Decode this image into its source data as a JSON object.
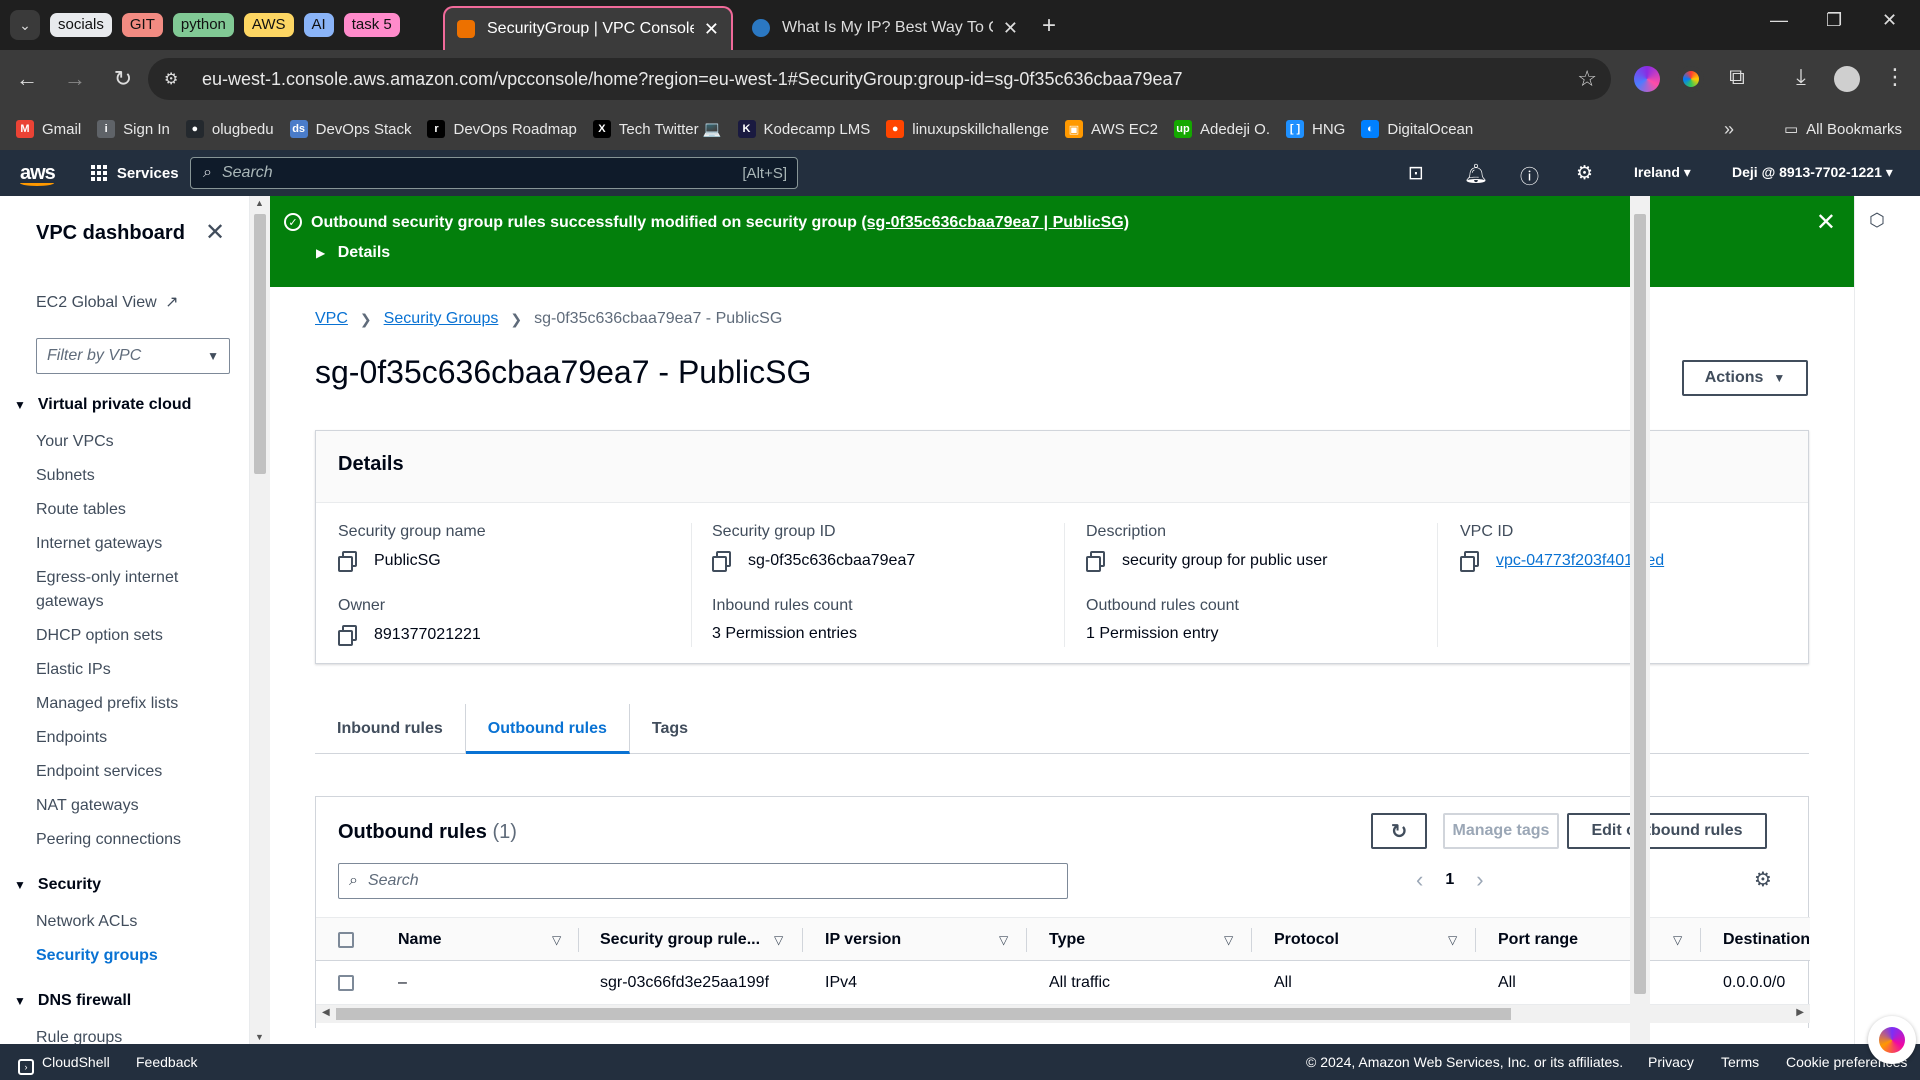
{
  "browser": {
    "tab_groups": [
      {
        "label": "socials",
        "color": "#e8eaed"
      },
      {
        "label": "GIT",
        "color": "#f28b82"
      },
      {
        "label": "python",
        "color": "#81c995"
      },
      {
        "label": "AWS",
        "color": "#fdd663"
      },
      {
        "label": "AI",
        "color": "#8ab4f8"
      },
      {
        "label": "task 5",
        "color": "#ff8bcb"
      }
    ],
    "active_tab": {
      "title": "SecurityGroup | VPC Console",
      "close": "✕"
    },
    "inactive_tab": {
      "title": "What Is My IP? Best Way To Check",
      "close": "✕"
    },
    "new_tab": "+",
    "url": "eu-west-1.console.aws.amazon.com/vpcconsole/home?region=eu-west-1#SecurityGroup:group-id=sg-0f35c636cbaa79ea7",
    "bookmarks": [
      {
        "label": "Gmail",
        "icon": "gmail-icon",
        "color": "#ea4335",
        "glyph": "M"
      },
      {
        "label": "Sign In",
        "icon": "signin-icon",
        "color": "#5f6368",
        "glyph": "i"
      },
      {
        "label": "olugbedu",
        "icon": "github-icon",
        "color": "#24292e",
        "glyph": "●"
      },
      {
        "label": "DevOps Stack",
        "icon": "devops-stack-icon",
        "color": "#4a7cc9",
        "glyph": "ds"
      },
      {
        "label": "DevOps Roadmap",
        "icon": "roadmap-icon",
        "color": "#000000",
        "glyph": "r"
      },
      {
        "label": "Tech Twitter 💻",
        "icon": "x-icon",
        "color": "#000000",
        "glyph": "X"
      },
      {
        "label": "Kodecamp LMS",
        "icon": "kodecamp-icon",
        "color": "#1a1a40",
        "glyph": "K"
      },
      {
        "label": "linuxupskillchallenge",
        "icon": "reddit-icon",
        "color": "#ff4500",
        "glyph": "●"
      },
      {
        "label": "AWS EC2",
        "icon": "aws-ec2-icon",
        "color": "#ff9900",
        "glyph": "▣"
      },
      {
        "label": "Adedeji O.",
        "icon": "upwork-icon",
        "color": "#14a800",
        "glyph": "up"
      },
      {
        "label": "HNG",
        "icon": "hng-icon",
        "color": "#1e90ff",
        "glyph": "[ ]"
      },
      {
        "label": "DigitalOcean",
        "icon": "digitalocean-icon",
        "color": "#0080ff",
        "glyph": "◐"
      }
    ],
    "bookmarks_more": "»",
    "all_bookmarks": "All Bookmarks"
  },
  "aws_nav": {
    "logo": "aws",
    "services": "Services",
    "search_placeholder": "Search",
    "search_shortcut": "[Alt+S]",
    "region": "Ireland ▾",
    "account": "Deji @ 8913-7702-1221 ▾"
  },
  "sidebar": {
    "title": "VPC dashboard",
    "ec2_global": "EC2 Global View",
    "filter_placeholder": "Filter by VPC",
    "sections": [
      {
        "label": "Virtual private cloud"
      },
      {
        "label": "Security"
      },
      {
        "label": "DNS firewall"
      }
    ],
    "vpc_items": [
      "Your VPCs",
      "Subnets",
      "Route tables",
      "Internet gateways",
      "Egress-only internet gateways",
      "DHCP option sets",
      "Elastic IPs",
      "Managed prefix lists",
      "Endpoints",
      "Endpoint services",
      "NAT gateways",
      "Peering connections"
    ],
    "security_items": [
      "Network ACLs",
      "Security groups"
    ],
    "dns_items": [
      "Rule groups"
    ]
  },
  "flash": {
    "message": "Outbound security group rules successfully modified on security group",
    "link": "(sg-0f35c636cbaa79ea7 | PublicSG)",
    "details": "Details",
    "color": "#037f0c"
  },
  "breadcrumb": {
    "vpc": "VPC",
    "security_groups": "Security Groups",
    "current": "sg-0f35c636cbaa79ea7 - PublicSG"
  },
  "page": {
    "title": "sg-0f35c636cbaa79ea7 - PublicSG",
    "actions": "Actions"
  },
  "details": {
    "header": "Details",
    "fields": {
      "sg_name": {
        "label": "Security group name",
        "value": "PublicSG"
      },
      "sg_id": {
        "label": "Security group ID",
        "value": "sg-0f35c636cbaa79ea7"
      },
      "description": {
        "label": "Description",
        "value": "security group for public user"
      },
      "vpc_id": {
        "label": "VPC ID",
        "value": "vpc-04773f203f401f0ed"
      },
      "owner": {
        "label": "Owner",
        "value": "891377021221"
      },
      "inbound_count": {
        "label": "Inbound rules count",
        "value": "3 Permission entries"
      },
      "outbound_count": {
        "label": "Outbound rules count",
        "value": "1 Permission entry"
      }
    }
  },
  "tabs": {
    "inbound": "Inbound rules",
    "outbound": "Outbound rules",
    "tags": "Tags"
  },
  "outbound": {
    "title": "Outbound rules",
    "count": "(1)",
    "manage_tags": "Manage tags",
    "edit": "Edit outbound rules",
    "search_placeholder": "Search",
    "page": "1",
    "columns": [
      "Name",
      "Security group rule...",
      "IP version",
      "Type",
      "Protocol",
      "Port range",
      "Destination"
    ],
    "rows": [
      {
        "name": "–",
        "rule_id": "sgr-03c66fd3e25aa199f",
        "ip_version": "IPv4",
        "type": "All traffic",
        "protocol": "All",
        "port_range": "All",
        "destination": "0.0.0.0/0"
      }
    ]
  },
  "footer": {
    "cloudshell": "CloudShell",
    "feedback": "Feedback",
    "copyright": "© 2024, Amazon Web Services, Inc. or its affiliates.",
    "privacy": "Privacy",
    "terms": "Terms",
    "cookie": "Cookie preferences"
  }
}
